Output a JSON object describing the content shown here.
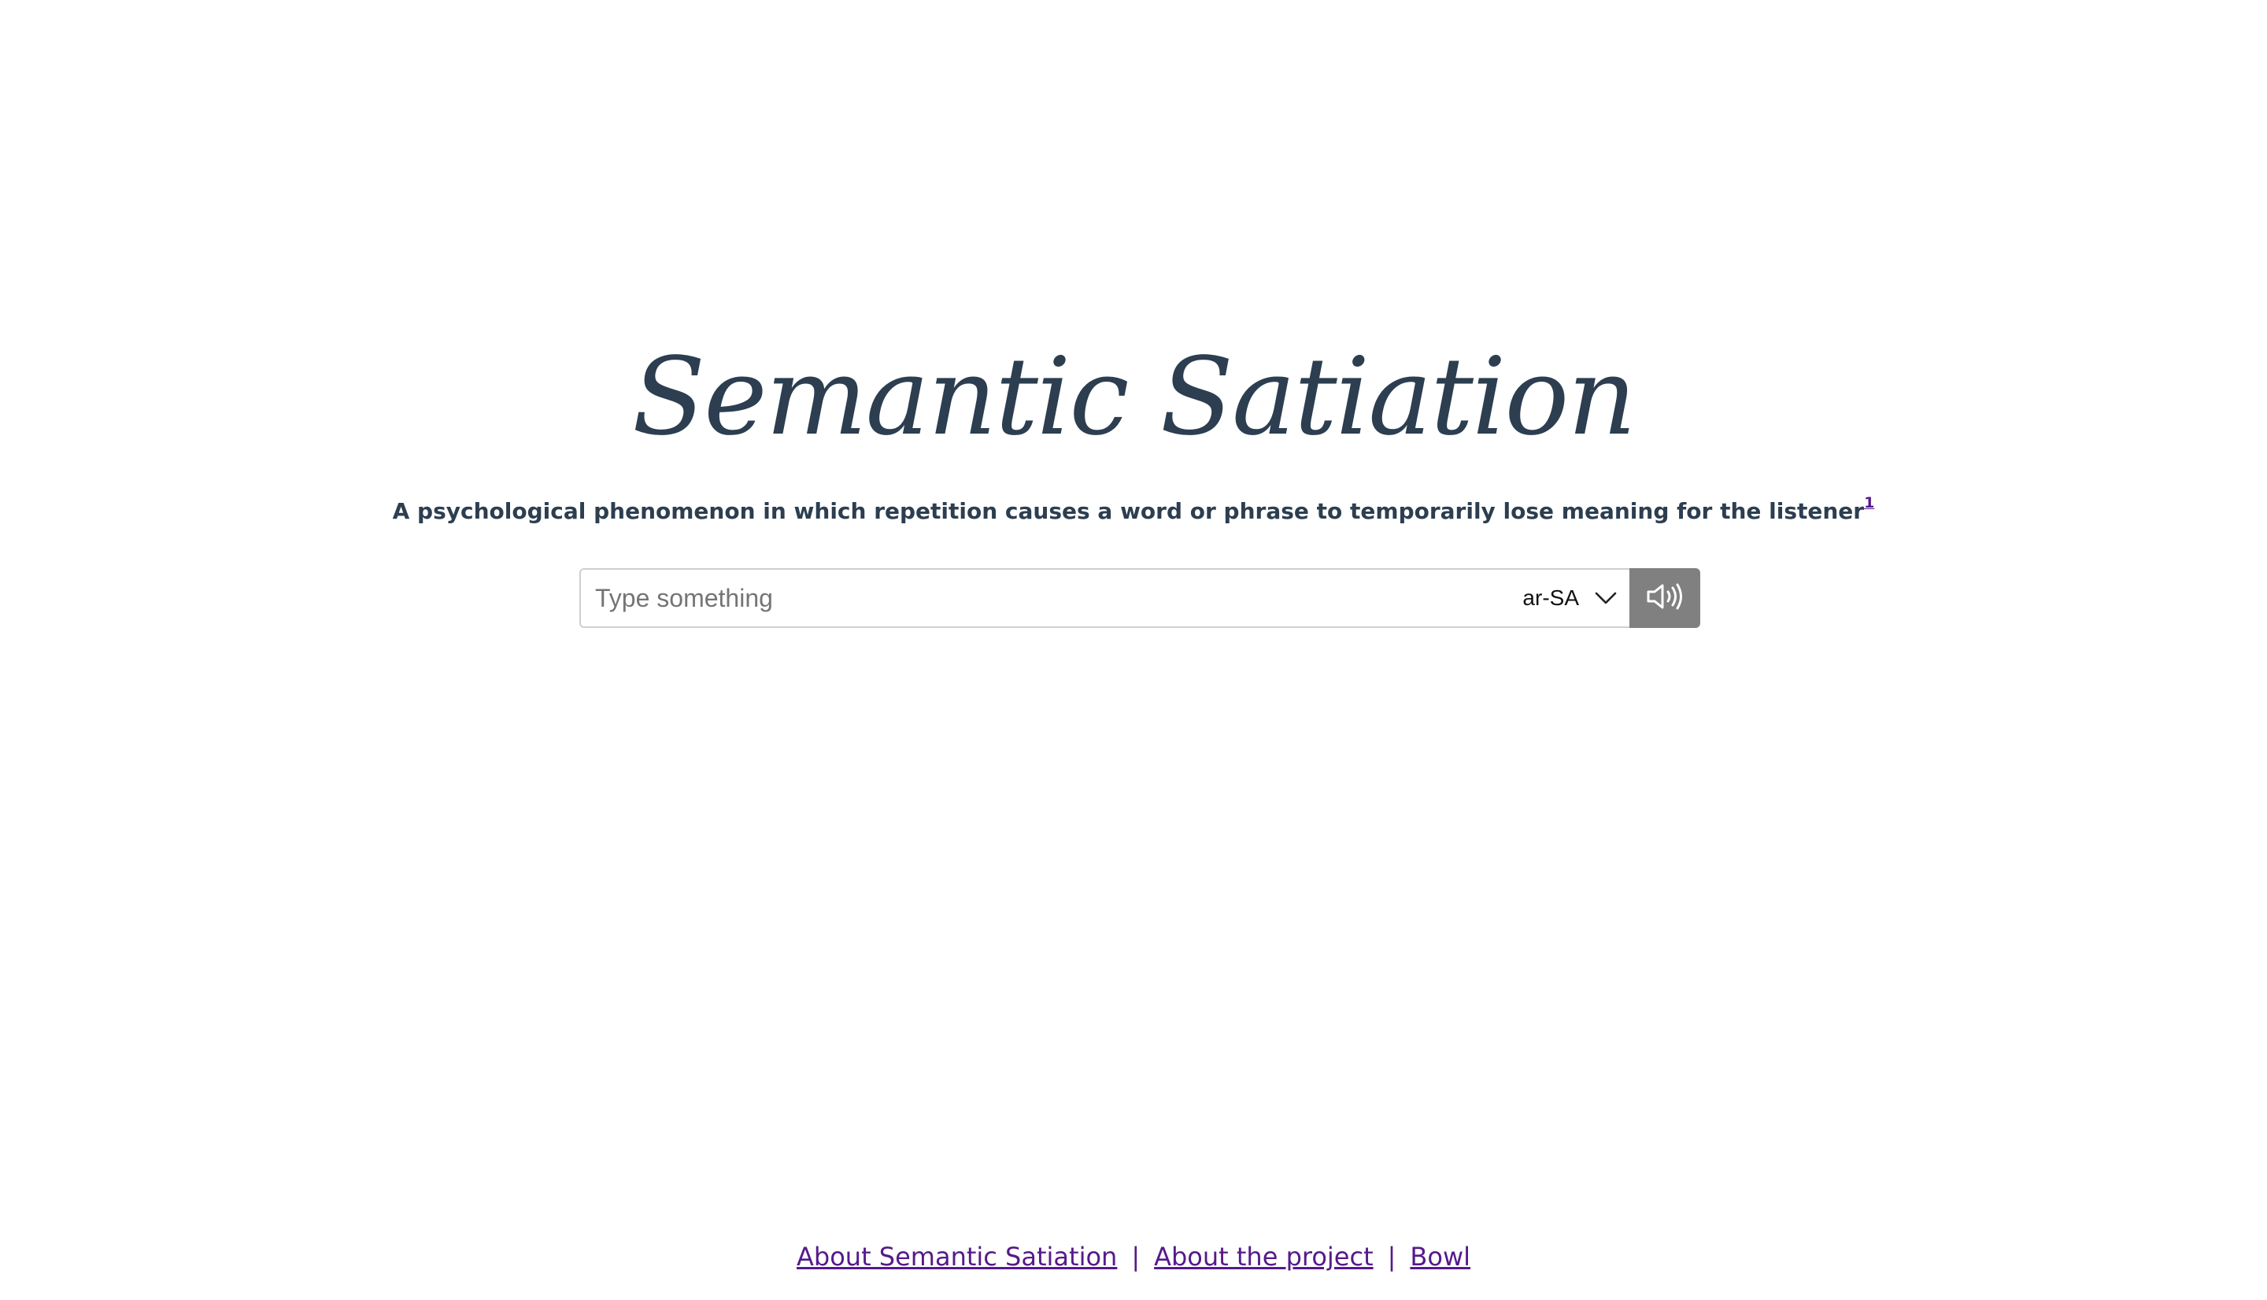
{
  "header": {
    "title": "Semantic Satiation",
    "subtitle": "A psychological phenomenon in which repetition causes a word or phrase to temporarily lose meaning for the listener",
    "footnote_ref": "1"
  },
  "speak_form": {
    "placeholder": "Type something",
    "value": "",
    "language": "ar-SA",
    "speak_icon": "speaker-icon",
    "dropdown_icon": "chevron-down-icon"
  },
  "footer": {
    "links": [
      {
        "label": "About Semantic Satiation"
      },
      {
        "label": "About the project"
      },
      {
        "label": "Bowl"
      }
    ],
    "separator": "|"
  },
  "colors": {
    "text": "#2c3e50",
    "link": "#551a8b",
    "button": "#808080",
    "border": "#cfcfcf"
  }
}
